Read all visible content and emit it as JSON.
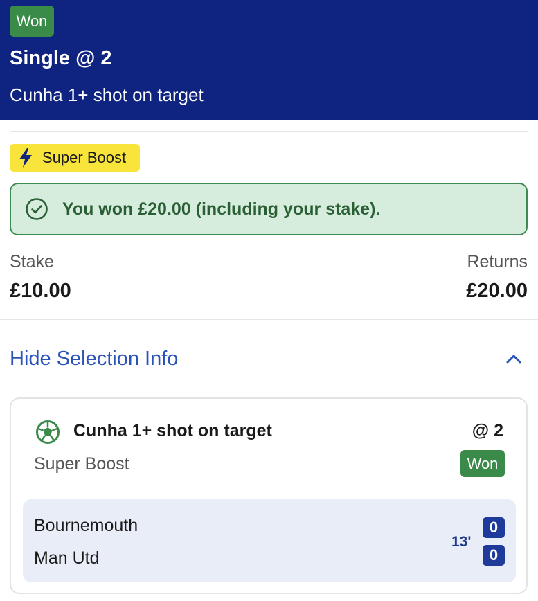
{
  "header": {
    "status_badge": "Won",
    "title": "Single @ 2",
    "subtitle": "Cunha 1+ shot on target"
  },
  "promo": {
    "label": "Super Boost",
    "icon": "lightning-bolt-icon"
  },
  "result_banner": {
    "icon": "check-circle-icon",
    "text": "You won £20.00 (including your stake)."
  },
  "summary": {
    "stake_label": "Stake",
    "stake_value": "£10.00",
    "returns_label": "Returns",
    "returns_value": "£20.00"
  },
  "toggle": {
    "label": "Hide Selection Info",
    "icon": "chevron-up-icon"
  },
  "selection": {
    "icon": "football-icon",
    "name": "Cunha 1+ shot on target",
    "odds": "@ 2",
    "type": "Super Boost",
    "status": "Won"
  },
  "match": {
    "home_team": "Bournemouth",
    "away_team": "Man Utd",
    "time": "13'",
    "home_score": "0",
    "away_score": "0"
  },
  "colors": {
    "header_bg": "#0f2380",
    "won_green": "#3a8a4a",
    "boost_yellow": "#f8e43a",
    "banner_bg": "#d6ecdc",
    "link_blue": "#2a52b8",
    "score_blue": "#1e3b9c"
  }
}
